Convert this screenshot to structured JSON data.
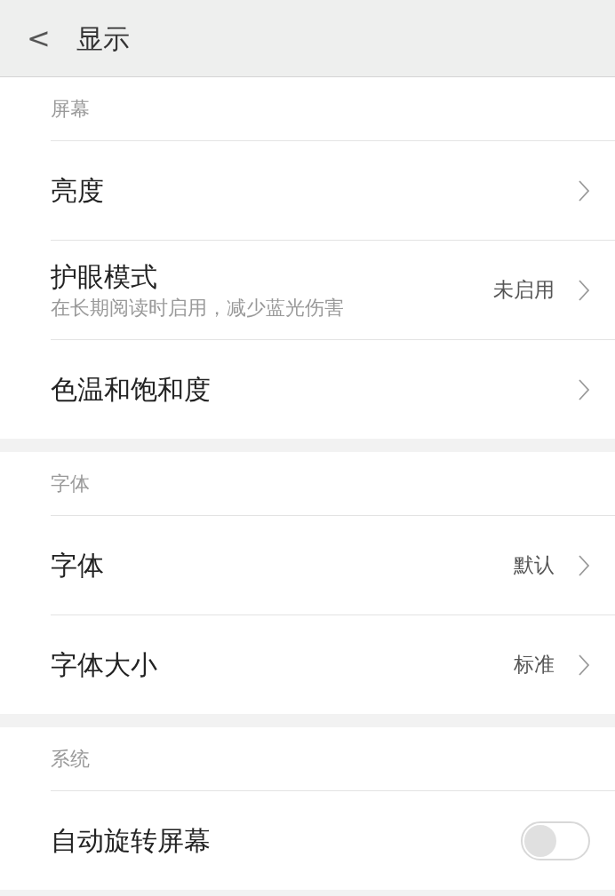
{
  "header": {
    "back": "<",
    "title": "显示"
  },
  "sections": [
    {
      "title": "屏幕",
      "items": [
        {
          "kind": "link",
          "label": "亮度"
        },
        {
          "kind": "link",
          "label": "护眼模式",
          "subtitle": "在长期阅读时启用，减少蓝光伤害",
          "value": "未启用"
        },
        {
          "kind": "link",
          "label": "色温和饱和度"
        }
      ]
    },
    {
      "title": "字体",
      "items": [
        {
          "kind": "link",
          "label": "字体",
          "value": "默认"
        },
        {
          "kind": "link",
          "label": "字体大小",
          "value": "标准"
        }
      ]
    },
    {
      "title": "系统",
      "items": [
        {
          "kind": "toggle",
          "label": "自动旋转屏幕",
          "on": false
        }
      ]
    }
  ]
}
